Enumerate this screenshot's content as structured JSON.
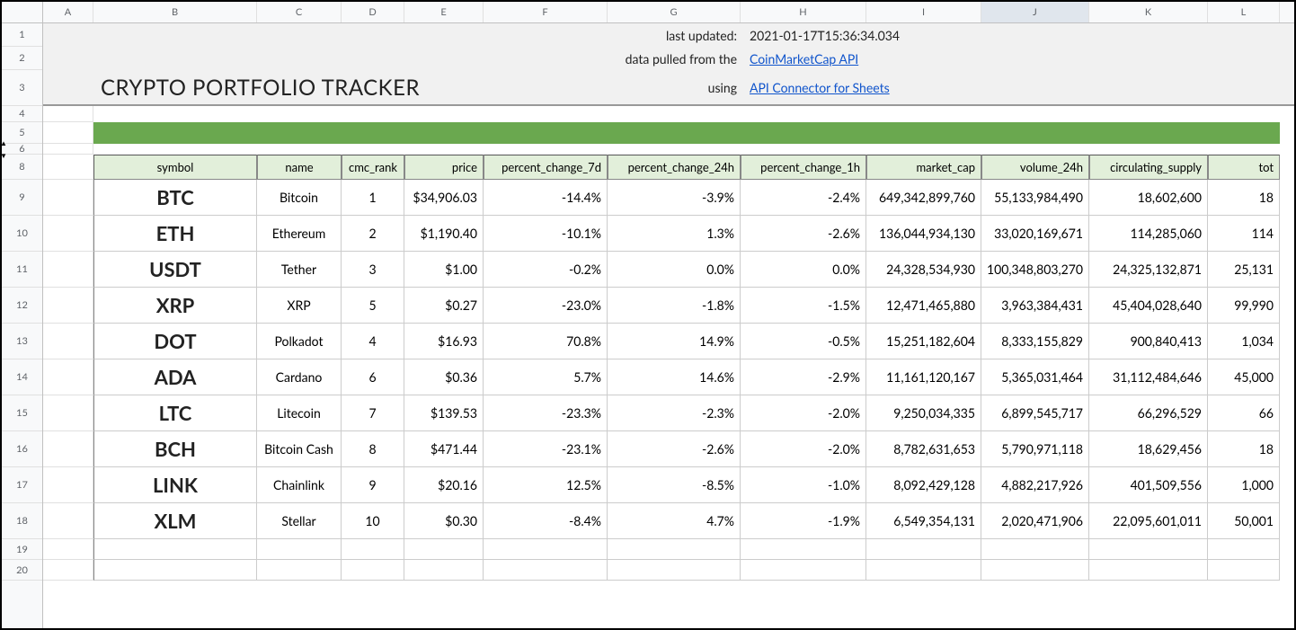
{
  "title": "CRYPTO PORTFOLIO TRACKER",
  "meta": {
    "last_updated_label": "last updated:",
    "last_updated_value": "2021-01-17T15:36:34.034",
    "source_label": "data pulled from the",
    "source_link": "CoinMarketCap API",
    "using_label": "using",
    "using_link": "API Connector for Sheets"
  },
  "columns": [
    "A",
    "B",
    "C",
    "D",
    "E",
    "F",
    "G",
    "H",
    "I",
    "J",
    "K",
    "L"
  ],
  "row_numbers": [
    "1",
    "2",
    "3",
    "4",
    "5",
    "6",
    "8",
    "9",
    "10",
    "11",
    "12",
    "13",
    "14",
    "15",
    "16",
    "17",
    "18",
    "19",
    "20"
  ],
  "table": {
    "headers": {
      "symbol": "symbol",
      "name": "name",
      "cmc_rank": "cmc_rank",
      "price": "price",
      "pc7d": "percent_change_7d",
      "pc24h": "percent_change_24h",
      "pc1h": "percent_change_1h",
      "market_cap": "market_cap",
      "volume_24h": "volume_24h",
      "circ_supply": "circulating_supply",
      "total": "tot"
    },
    "rows": [
      {
        "symbol": "BTC",
        "name": "Bitcoin",
        "rank": "1",
        "price": "$34,906.03",
        "pc7d": "-14.4%",
        "pc24h": "-3.9%",
        "pc1h": "-2.4%",
        "mcap": "649,342,899,760",
        "vol": "55,133,984,490",
        "circ": "18,602,600",
        "tot": "18"
      },
      {
        "symbol": "ETH",
        "name": "Ethereum",
        "rank": "2",
        "price": "$1,190.40",
        "pc7d": "-10.1%",
        "pc24h": "1.3%",
        "pc1h": "-2.6%",
        "mcap": "136,044,934,130",
        "vol": "33,020,169,671",
        "circ": "114,285,060",
        "tot": "114"
      },
      {
        "symbol": "USDT",
        "name": "Tether",
        "rank": "3",
        "price": "$1.00",
        "pc7d": "-0.2%",
        "pc24h": "0.0%",
        "pc1h": "0.0%",
        "mcap": "24,328,534,930",
        "vol": "100,348,803,270",
        "circ": "24,325,132,871",
        "tot": "25,131"
      },
      {
        "symbol": "XRP",
        "name": "XRP",
        "rank": "5",
        "price": "$0.27",
        "pc7d": "-23.0%",
        "pc24h": "-1.8%",
        "pc1h": "-1.5%",
        "mcap": "12,471,465,880",
        "vol": "3,963,384,431",
        "circ": "45,404,028,640",
        "tot": "99,990"
      },
      {
        "symbol": "DOT",
        "name": "Polkadot",
        "rank": "4",
        "price": "$16.93",
        "pc7d": "70.8%",
        "pc24h": "14.9%",
        "pc1h": "-0.5%",
        "mcap": "15,251,182,604",
        "vol": "8,333,155,829",
        "circ": "900,840,413",
        "tot": "1,034"
      },
      {
        "symbol": "ADA",
        "name": "Cardano",
        "rank": "6",
        "price": "$0.36",
        "pc7d": "5.7%",
        "pc24h": "14.6%",
        "pc1h": "-2.9%",
        "mcap": "11,161,120,167",
        "vol": "5,365,031,464",
        "circ": "31,112,484,646",
        "tot": "45,000"
      },
      {
        "symbol": "LTC",
        "name": "Litecoin",
        "rank": "7",
        "price": "$139.53",
        "pc7d": "-23.3%",
        "pc24h": "-2.3%",
        "pc1h": "-2.0%",
        "mcap": "9,250,034,335",
        "vol": "6,899,545,717",
        "circ": "66,296,529",
        "tot": "66"
      },
      {
        "symbol": "BCH",
        "name": "Bitcoin Cash",
        "rank": "8",
        "price": "$471.44",
        "pc7d": "-23.1%",
        "pc24h": "-2.6%",
        "pc1h": "-2.0%",
        "mcap": "8,782,631,653",
        "vol": "5,790,971,118",
        "circ": "18,629,456",
        "tot": "18"
      },
      {
        "symbol": "LINK",
        "name": "Chainlink",
        "rank": "9",
        "price": "$20.16",
        "pc7d": "12.5%",
        "pc24h": "-8.5%",
        "pc1h": "-1.0%",
        "mcap": "8,092,429,128",
        "vol": "4,882,217,926",
        "circ": "401,509,556",
        "tot": "1,000"
      },
      {
        "symbol": "XLM",
        "name": "Stellar",
        "rank": "10",
        "price": "$0.30",
        "pc7d": "-8.4%",
        "pc24h": "4.7%",
        "pc1h": "-1.9%",
        "mcap": "6,549,354,131",
        "vol": "2,020,471,906",
        "circ": "22,095,601,011",
        "tot": "50,001"
      }
    ]
  }
}
